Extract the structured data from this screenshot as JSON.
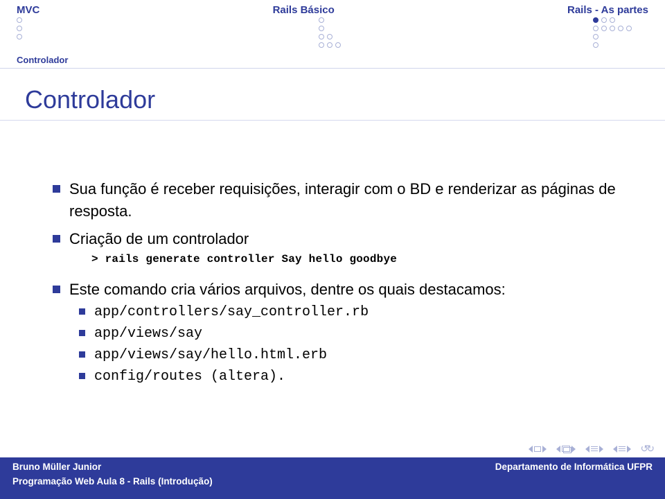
{
  "nav": {
    "items": [
      "MVC",
      "Rails Básico",
      "Rails - As partes"
    ],
    "active_index": 2
  },
  "subsection": "Controlador",
  "title": "Controlador",
  "bullets": {
    "b0": "Sua função é receber requisições, interagir com o BD e renderizar as páginas de resposta.",
    "b1": "Criação de um controlador",
    "code": "> rails generate controller Say hello goodbye",
    "b2": "Este comando cria vários arquivos, dentre os quais destacamos:",
    "sub": [
      "app/controllers/say_controller.rb",
      "app/views/say",
      "app/views/say/hello.html.erb",
      "config/routes (altera)."
    ]
  },
  "footer": {
    "author": "Bruno Müller Junior",
    "affiliation": "Departamento de Informática   UFPR",
    "course": "Programação Web   Aula 8 - Rails (Introdução)"
  },
  "controls": {
    "frame_back": "frame-back",
    "frame_fwd": "frame-forward",
    "section_back": "section-back",
    "section_fwd": "section-forward",
    "sub_back": "subsection-back",
    "sub_fwd": "subsection-forward",
    "slide_back": "slide-back",
    "slide_fwd": "slide-forward",
    "redo": "redo"
  }
}
